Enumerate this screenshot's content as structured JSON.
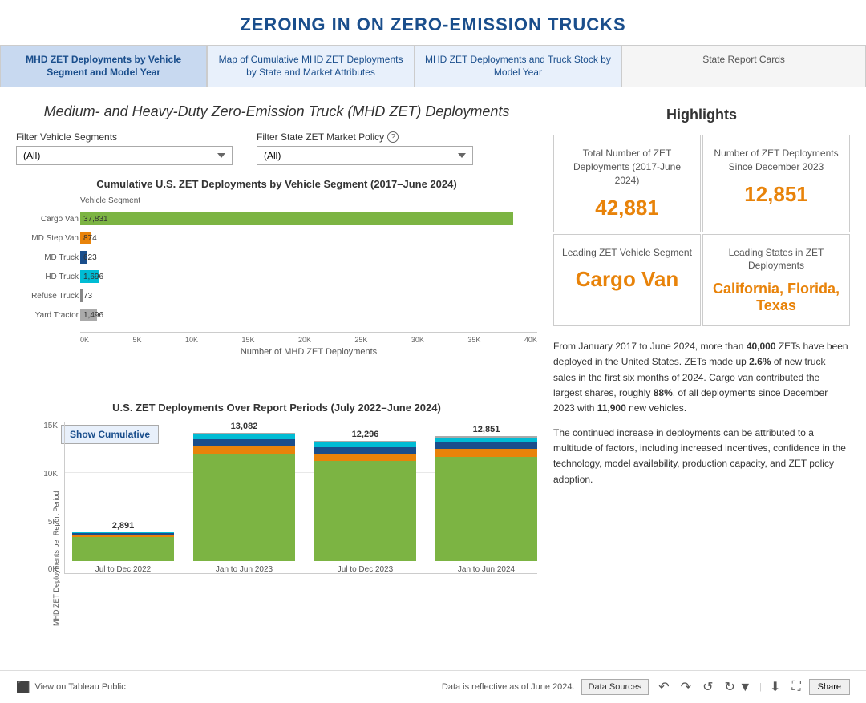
{
  "header": {
    "title": "ZEROING IN ON ZERO-EMISSION TRUCKS"
  },
  "nav": {
    "tabs": [
      {
        "id": "tab1",
        "label": "MHD ZET Deployments by Vehicle Segment and Model Year",
        "active": true
      },
      {
        "id": "tab2",
        "label": "Map of Cumulative MHD ZET Deployments by State and Market Attributes",
        "active": false
      },
      {
        "id": "tab3",
        "label": "MHD ZET Deployments and Truck Stock by Model Year",
        "active": false
      },
      {
        "id": "tab4",
        "label": "State Report Cards",
        "active": false
      }
    ]
  },
  "main": {
    "subtitle_part1": "Medium- and Heavy-Duty ",
    "subtitle_part2": "Zero-Emission Truck (MHD ZET) Deployments",
    "filters": {
      "vehicle_segments": {
        "label": "Filter Vehicle Segments",
        "placeholder": "(All)",
        "options": [
          "(All)"
        ]
      },
      "state_zet": {
        "label": "Filter State ZET Market Policy",
        "placeholder": "(All)",
        "options": [
          "(All)"
        ]
      }
    },
    "bar_chart": {
      "title": "Cumulative U.S. ZET Deployments by Vehicle Segment (2017–June 2024)",
      "y_label": "Vehicle Segment",
      "x_label": "Number of MHD ZET Deployments",
      "bars": [
        {
          "label": "Cargo Van",
          "value": 37831,
          "color": "green",
          "width_pct": 94
        },
        {
          "label": "MD Step Van",
          "value": 874,
          "color": "orange",
          "width_pct": 2.2
        },
        {
          "label": "MD Truck",
          "value": 623,
          "color": "dark-blue",
          "width_pct": 1.6
        },
        {
          "label": "HD Truck",
          "value": 1696,
          "color": "cyan",
          "width_pct": 4.2
        },
        {
          "label": "Refuse Truck",
          "value": 73,
          "color": "none",
          "width_pct": 0.5
        },
        {
          "label": "Yard Tractor",
          "value": 1496,
          "color": "gray",
          "width_pct": 3.7
        }
      ],
      "x_axis": [
        "0K",
        "5K",
        "10K",
        "15K",
        "20K",
        "25K",
        "30K",
        "35K",
        "40K"
      ]
    },
    "time_chart": {
      "title": "U.S. ZET Deployments Over Report Periods (July 2022–June 2024)",
      "y_axis": [
        "0K",
        "5K",
        "10K",
        "15K"
      ],
      "y_label": "MHD ZET Deployments per Report Period",
      "show_cumulative_btn": "Show Cumulative",
      "bars": [
        {
          "period": "Jul to Dec 2022",
          "total": 2891,
          "total_label": "2,891",
          "segments": [
            {
              "value": 2600,
              "color": "#7cb443",
              "height_pct": 57
            },
            {
              "value": 200,
              "color": "#e8830a",
              "height_pct": 4
            },
            {
              "value": 50,
              "color": "#1a4e8c",
              "height_pct": 1
            },
            {
              "value": 41,
              "color": "#00bcd4",
              "height_pct": 1
            }
          ]
        },
        {
          "period": "Jan to Jun 2023",
          "total": 13082,
          "total_label": "13,082",
          "segments": [
            {
              "value": 11500,
              "color": "#7cb443",
              "height_pct": 84
            },
            {
              "value": 800,
              "color": "#e8830a",
              "height_pct": 6
            },
            {
              "value": 400,
              "color": "#1a4e8c",
              "height_pct": 3
            },
            {
              "value": 382,
              "color": "#00bcd4",
              "height_pct": 3
            }
          ]
        },
        {
          "period": "Jul to Dec 2023",
          "total": 12296,
          "total_label": "12,296",
          "segments": [
            {
              "value": 10800,
              "color": "#7cb443",
              "height_pct": 79
            },
            {
              "value": 700,
              "color": "#e8830a",
              "height_pct": 5
            },
            {
              "value": 400,
              "color": "#1a4e8c",
              "height_pct": 3
            },
            {
              "value": 396,
              "color": "#00bcd4",
              "height_pct": 3
            }
          ]
        },
        {
          "period": "Jan to Jun 2024",
          "total": 12851,
          "total_label": "12,851",
          "segments": [
            {
              "value": 11300,
              "color": "#7cb443",
              "height_pct": 82
            },
            {
              "value": 750,
              "color": "#e8830a",
              "height_pct": 5
            },
            {
              "value": 450,
              "color": "#1a4e8c",
              "height_pct": 3
            },
            {
              "value": 351,
              "color": "#00bcd4",
              "height_pct": 3
            }
          ]
        }
      ]
    }
  },
  "highlights": {
    "title": "Highlights",
    "cards": [
      {
        "id": "card1",
        "title": "Total Number of ZET Deployments (2017-June 2024)",
        "value": "42,881"
      },
      {
        "id": "card2",
        "title": "Number of ZET Deployments Since December 2023",
        "value": "12,851"
      },
      {
        "id": "card3",
        "title": "Leading ZET Vehicle Segment",
        "value": "Cargo Van"
      },
      {
        "id": "card4",
        "title": "Leading States in ZET Deployments",
        "value": "California, Florida, Texas"
      }
    ],
    "description": [
      "From January 2017 to June 2024, more than <strong>40,000</strong> ZETs have been deployed in the United States. ZETs made up <strong>2.6%</strong> of new truck sales in the first six months of 2024. Cargo van contributed the largest shares, roughly <strong>88%</strong>, of all deployments since December 2023 with <strong>11,900</strong> new vehicles.",
      "The continued increase in deployments can be attributed to a multitude of factors, including increased incentives, confidence in the technology, model availability, production capacity, and ZET policy adoption."
    ]
  },
  "footer": {
    "tableau_label": "View on Tableau Public",
    "data_note": "Data is reflective as of June 2024.",
    "data_sources_btn": "Data Sources",
    "share_btn": "Share"
  }
}
